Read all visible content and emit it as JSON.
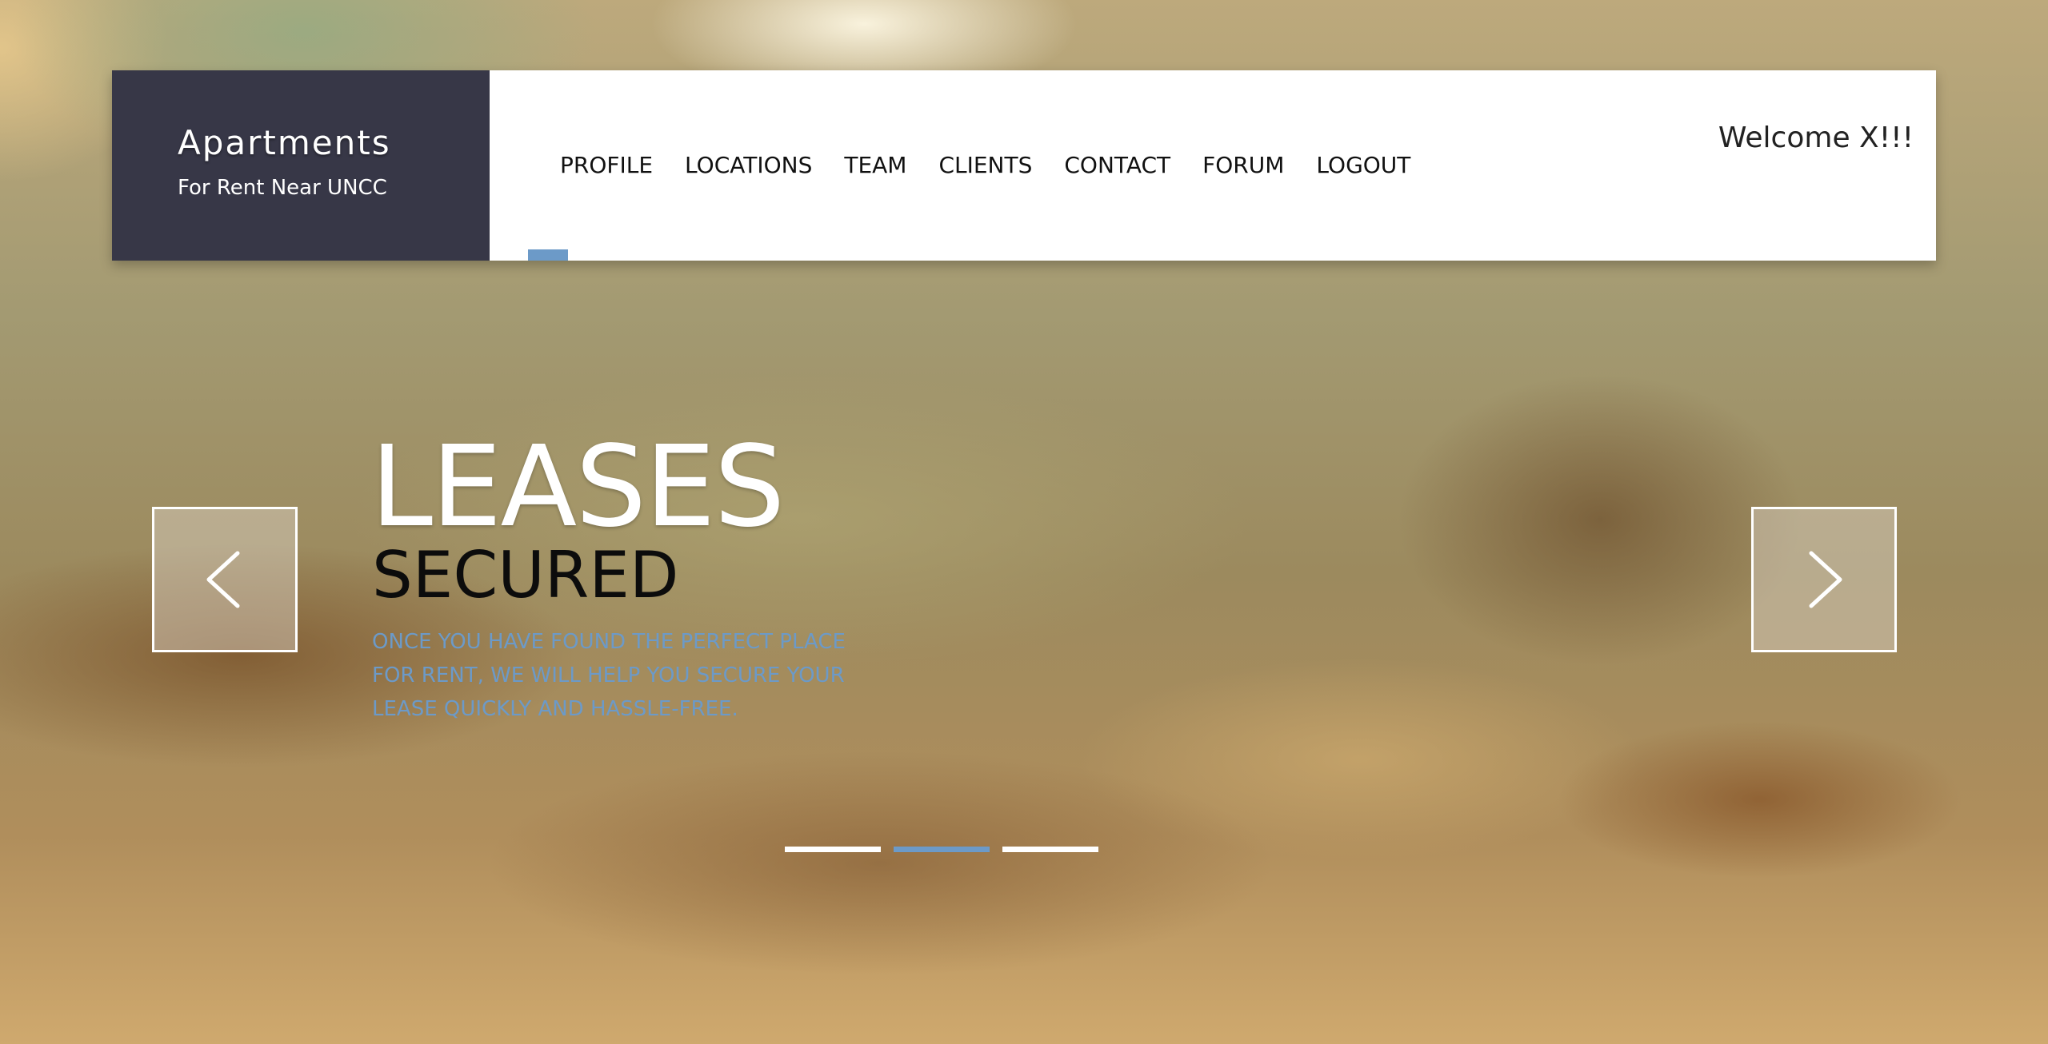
{
  "brand": {
    "title": "Apartments",
    "subtitle": "For Rent Near UNCC"
  },
  "nav": {
    "items": [
      {
        "label": "PROFILE"
      },
      {
        "label": "LOCATIONS"
      },
      {
        "label": "TEAM"
      },
      {
        "label": "CLIENTS"
      },
      {
        "label": "CONTACT"
      },
      {
        "label": "FORUM"
      },
      {
        "label": "LOGOUT"
      }
    ],
    "active_index": 0
  },
  "welcome": "Welcome X!!!",
  "slider": {
    "title": "LEASES",
    "subtitle": "SECURED",
    "description_lines": [
      "ONCE YOU HAVE FOUND THE PERFECT PLACE",
      "FOR RENT, WE WILL HELP YOU SECURE YOUR",
      "LEASE QUICKLY AND HASSLE-FREE."
    ],
    "prev_icon": "chevron-left-icon",
    "next_icon": "chevron-right-icon",
    "dots": 3,
    "active_dot": 2
  },
  "colors": {
    "brand_bg": "#373747",
    "accent": "#6c9ac8",
    "header_bg": "#ffffff"
  }
}
